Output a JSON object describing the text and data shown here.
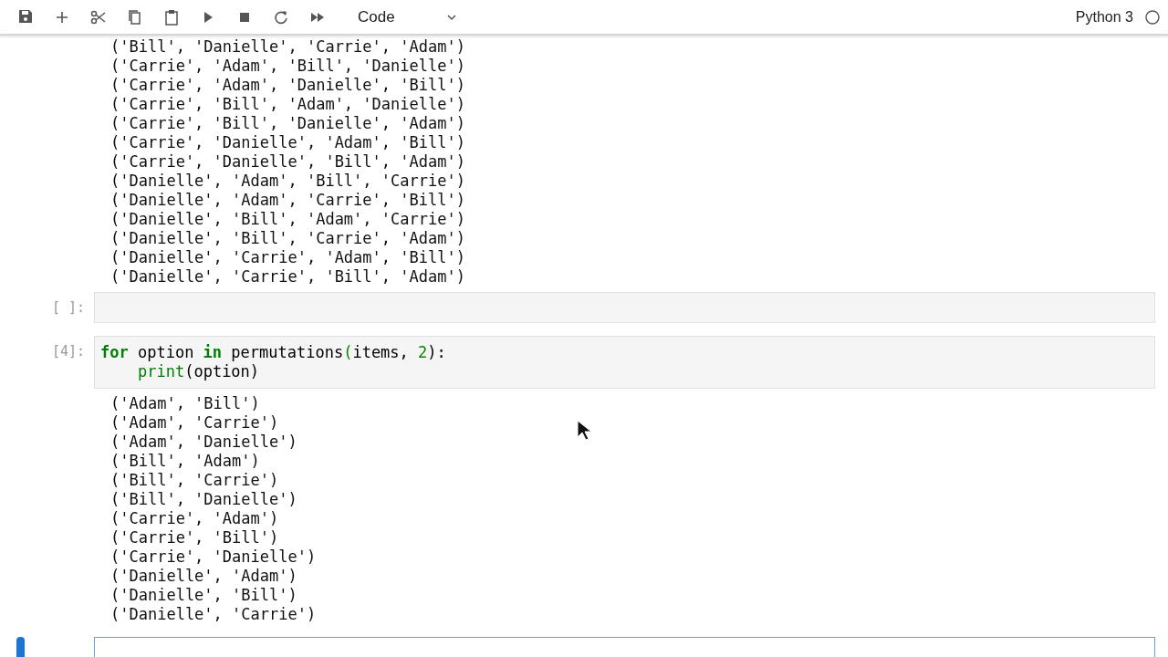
{
  "toolbar": {
    "cell_type": "Code",
    "kernel_name": "Python 3"
  },
  "cells": [
    {
      "kind": "output",
      "lines": [
        "('Bill', 'Danielle', 'Carrie', 'Adam')",
        "('Carrie', 'Adam', 'Bill', 'Danielle')",
        "('Carrie', 'Adam', 'Danielle', 'Bill')",
        "('Carrie', 'Bill', 'Adam', 'Danielle')",
        "('Carrie', 'Bill', 'Danielle', 'Adam')",
        "('Carrie', 'Danielle', 'Adam', 'Bill')",
        "('Carrie', 'Danielle', 'Bill', 'Adam')",
        "('Danielle', 'Adam', 'Bill', 'Carrie')",
        "('Danielle', 'Adam', 'Carrie', 'Bill')",
        "('Danielle', 'Bill', 'Adam', 'Carrie')",
        "('Danielle', 'Bill', 'Carrie', 'Adam')",
        "('Danielle', 'Carrie', 'Adam', 'Bill')",
        "('Danielle', 'Carrie', 'Bill', 'Adam')"
      ]
    },
    {
      "kind": "code",
      "prompt": "[ ]:",
      "selected": false
    },
    {
      "kind": "code",
      "prompt": "[4]:",
      "selected": false,
      "code": [
        {
          "indent": false,
          "tokens": [
            {
              "text": "for",
              "kind": "keyword"
            },
            {
              "text": " option ",
              "kind": "plain"
            },
            {
              "text": "in",
              "kind": "keyword"
            },
            {
              "text": " permutations",
              "kind": "plain"
            },
            {
              "text": "(",
              "kind": "paren"
            },
            {
              "text": "items, ",
              "kind": "plain"
            },
            {
              "text": "2",
              "kind": "number"
            },
            {
              "text": "):",
              "kind": "plain"
            }
          ]
        },
        {
          "indent": true,
          "tokens": [
            {
              "text": "print",
              "kind": "builtin"
            },
            {
              "text": "(option)",
              "kind": "plain"
            }
          ]
        }
      ]
    },
    {
      "kind": "output",
      "lines": [
        "('Adam', 'Bill')",
        "('Adam', 'Carrie')",
        "('Adam', 'Danielle')",
        "('Bill', 'Adam')",
        "('Bill', 'Carrie')",
        "('Bill', 'Danielle')",
        "('Carrie', 'Adam')",
        "('Carrie', 'Bill')",
        "('Carrie', 'Danielle')",
        "('Danielle', 'Adam')",
        "('Danielle', 'Bill')",
        "('Danielle', 'Carrie')"
      ]
    },
    {
      "kind": "code",
      "selected": true
    }
  ]
}
